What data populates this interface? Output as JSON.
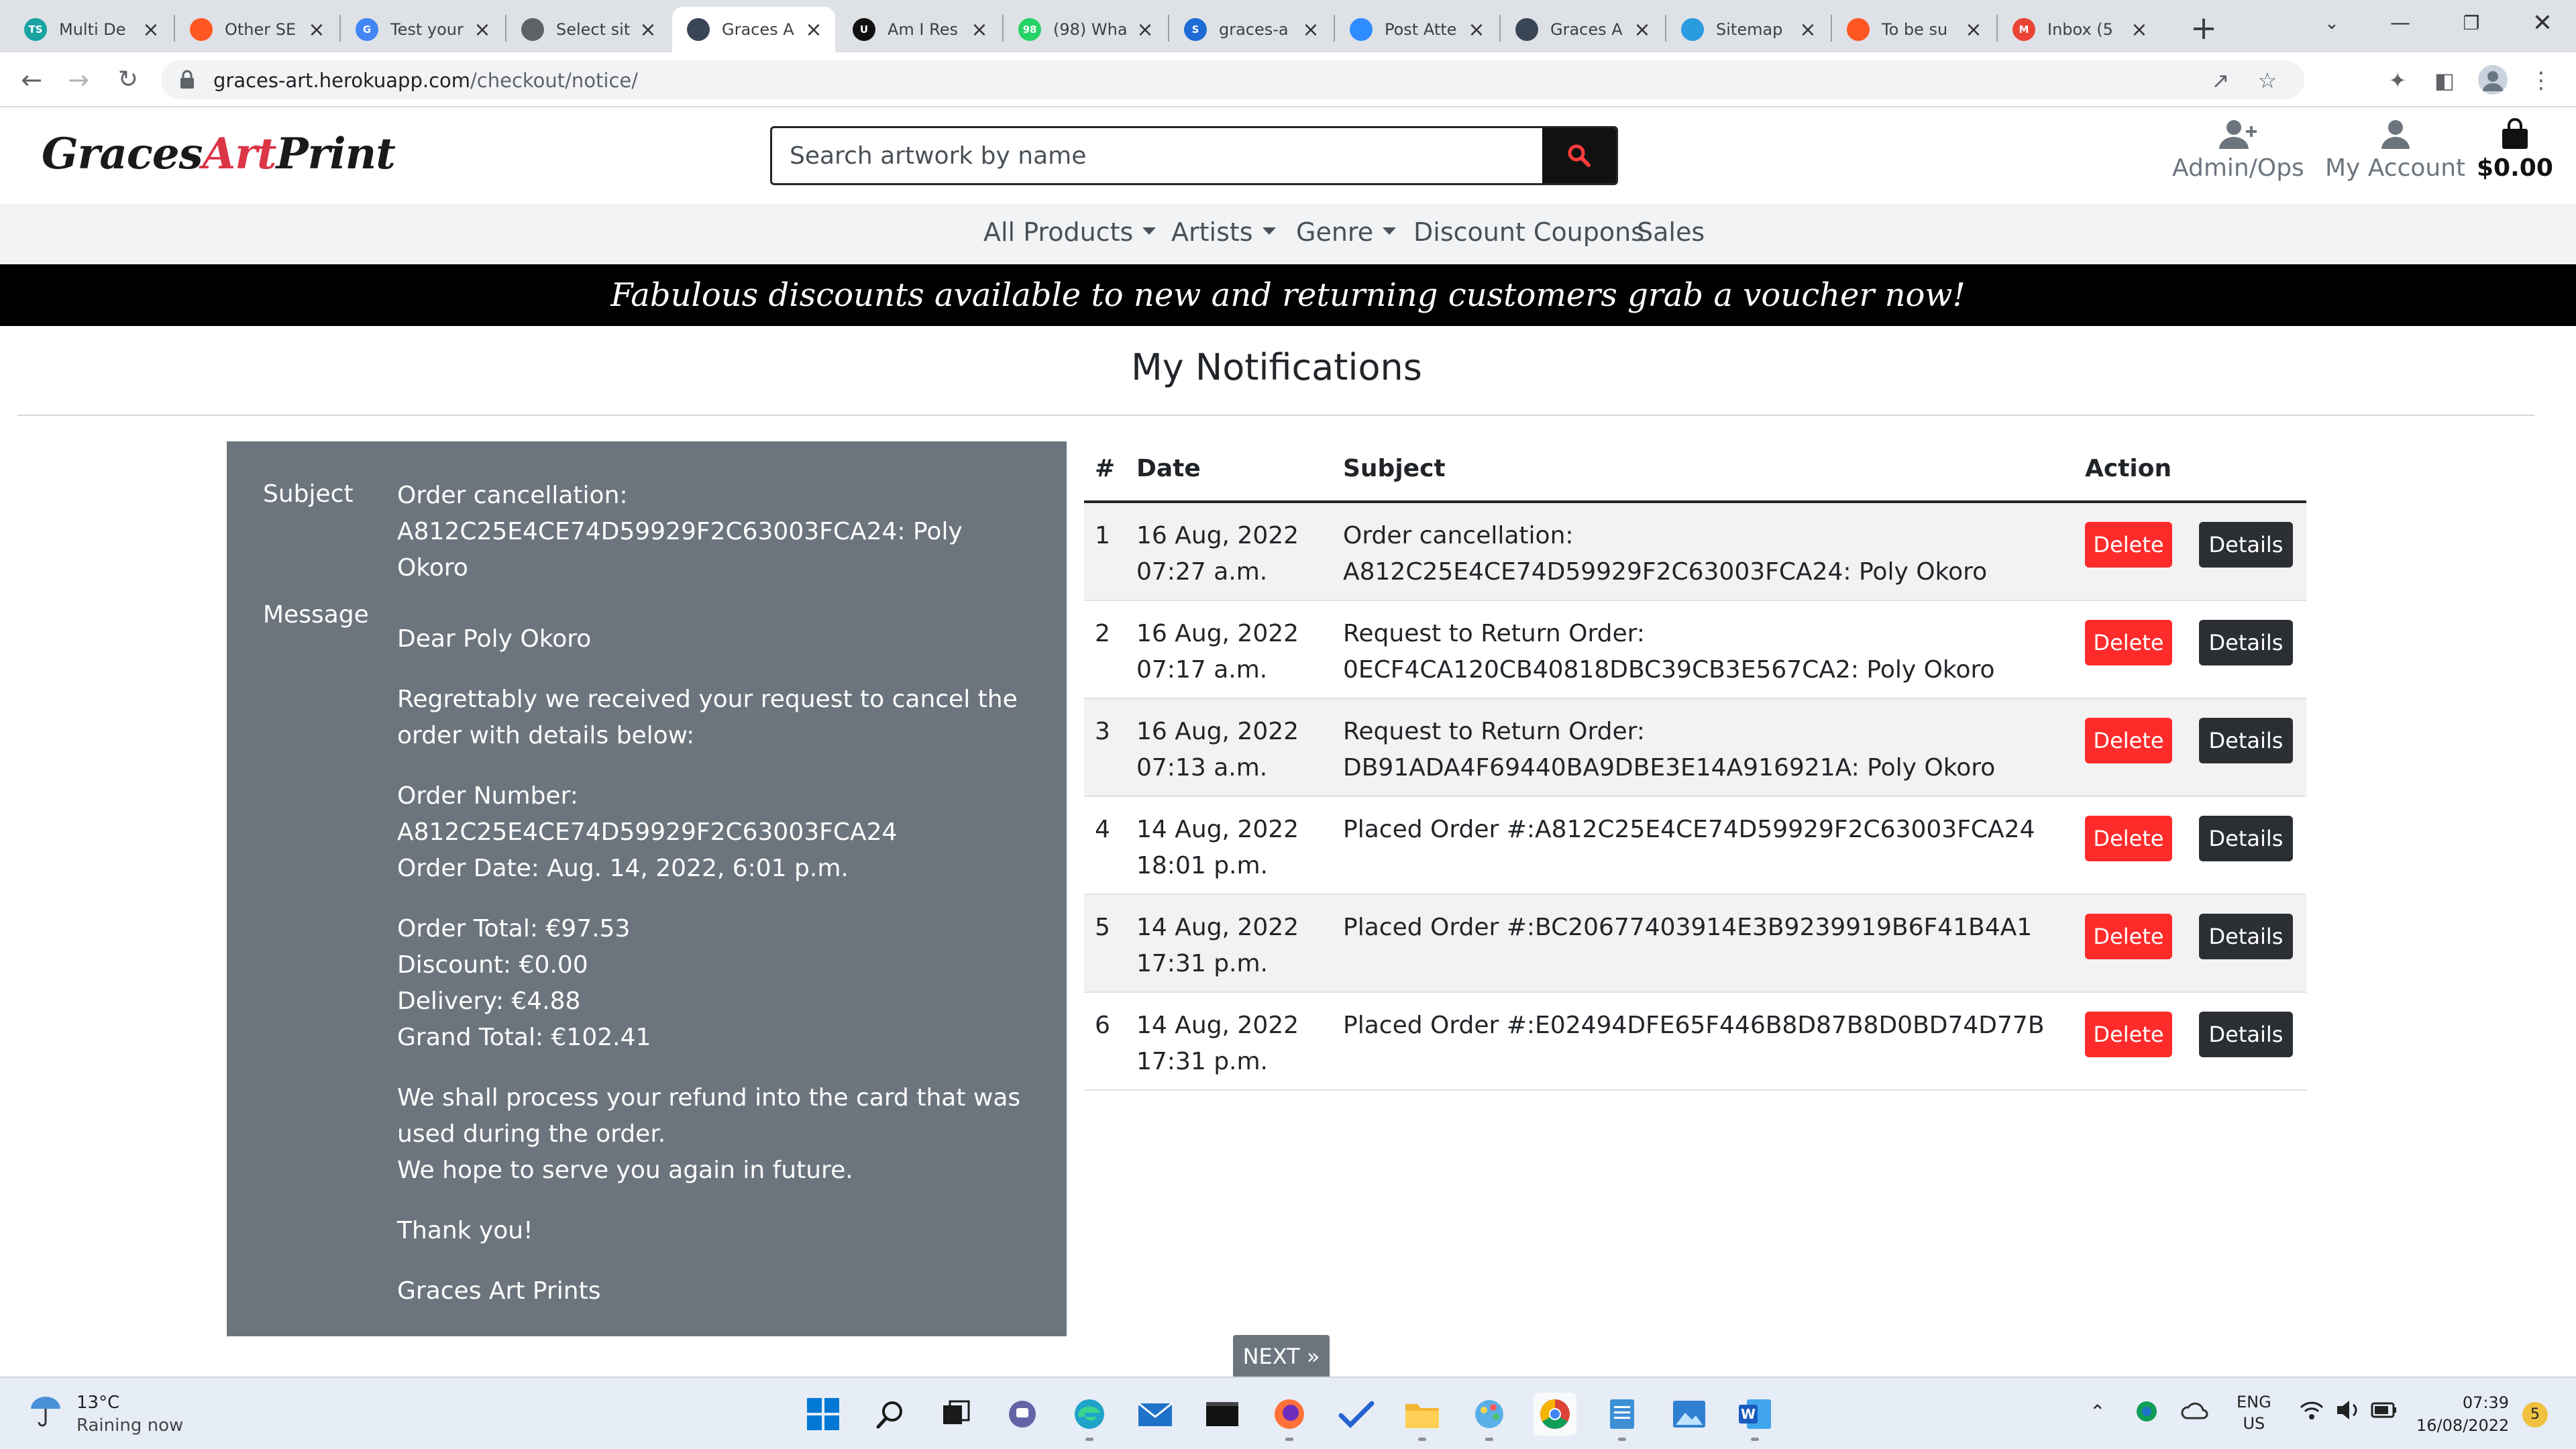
{
  "browser": {
    "tabs": [
      {
        "title": "Multi De",
        "favicon": "ts-circle-icon",
        "color": "#19a3a3",
        "glyph": "TS"
      },
      {
        "title": "Other SE",
        "favicon": "ring-icon",
        "color": "#ff5722",
        "glyph": ""
      },
      {
        "title": "Test your",
        "favicon": "google-icon",
        "color": "#4285f4",
        "glyph": "G"
      },
      {
        "title": "Select sit",
        "favicon": "globe-icon",
        "color": "#5f6368",
        "glyph": ""
      },
      {
        "title": "Graces A",
        "favicon": "graces-icon",
        "color": "#3a4655",
        "glyph": ""
      },
      {
        "title": "Am I Res",
        "favicon": "uploader-icon",
        "color": "#111111",
        "glyph": "U"
      },
      {
        "title": "(98) Wha",
        "favicon": "whatsapp-icon",
        "color": "#25d366",
        "glyph": "98"
      },
      {
        "title": "graces-a",
        "favicon": "s-icon",
        "color": "#1e6bd6",
        "glyph": "S"
      },
      {
        "title": "Post Atte",
        "favicon": "video-icon",
        "color": "#2d8cff",
        "glyph": ""
      },
      {
        "title": "Graces A",
        "favicon": "graces-icon",
        "color": "#3a4655",
        "glyph": ""
      },
      {
        "title": "Sitemap",
        "favicon": "sitemap-icon",
        "color": "#2b9be0",
        "glyph": ""
      },
      {
        "title": "To be su",
        "favicon": "ring-icon",
        "color": "#ff5722",
        "glyph": ""
      },
      {
        "title": "Inbox (5",
        "favicon": "gmail-icon",
        "color": "#ea4335",
        "glyph": "M"
      }
    ],
    "active_tab": 4,
    "url_host": "graces-art.herokuapp.com",
    "url_path": "/checkout/notice/"
  },
  "site": {
    "logo": {
      "part1": "Graces",
      "part2": "Art",
      "part3": "Print"
    },
    "search_placeholder": "Search artwork by name",
    "header_links": {
      "admin": "Admin/Ops",
      "account": "My Account",
      "bag": "$0.00"
    },
    "nav": [
      "All Products",
      "Artists",
      "Genre",
      "Discount Coupons",
      "Sales"
    ],
    "banner": "Fabulous discounts available to new and returning customers grab a voucher now!",
    "page_title": "My Notifications",
    "colors": {
      "accent": "#dc3545",
      "panel": "#6c757d",
      "delete": "#ff2b2b",
      "details": "#2b2f33"
    }
  },
  "detail": {
    "subject_label": "Subject",
    "subject": "Order cancellation: A812C25E4CE74D59929F2C63003FCA24: Poly Okoro",
    "message_label": "Message",
    "greeting": "Dear Poly Okoro",
    "para1": "Regrettably we received your request to cancel the order with details below:",
    "order_number_line": "Order Number:",
    "order_number": "A812C25E4CE74D59929F2C63003FCA24",
    "order_date": "Order Date: Aug. 14, 2022, 6:01 p.m.",
    "order_total": "Order Total: €97.53",
    "discount": "Discount: €0.00",
    "delivery": "Delivery: €4.88",
    "grand_total": "Grand Total: €102.41",
    "refund1": "We shall process your refund into the card that was used during the order.",
    "refund2": "We hope to serve you again in future.",
    "thanks": "Thank you!",
    "signature": "Graces Art Prints"
  },
  "table": {
    "headers": {
      "num": "#",
      "date": "Date",
      "subject": "Subject",
      "action": "Action"
    },
    "delete_label": "Delete",
    "details_label": "Details",
    "rows": [
      {
        "num": "1",
        "date": "16 Aug, 2022",
        "time": "07:27 a.m.",
        "subject": "Order cancellation: A812C25E4CE74D59929F2C63003FCA24: Poly Okoro"
      },
      {
        "num": "2",
        "date": "16 Aug, 2022",
        "time": "07:17 a.m.",
        "subject": "Request to Return Order: 0ECF4CA120CB40818DBC39CB3E567CA2: Poly Okoro"
      },
      {
        "num": "3",
        "date": "16 Aug, 2022",
        "time": "07:13 a.m.",
        "subject": "Request to Return Order: DB91ADA4F69440BA9DBE3E14A916921A: Poly Okoro"
      },
      {
        "num": "4",
        "date": "14 Aug, 2022",
        "time": "18:01 p.m.",
        "subject": "Placed Order #:A812C25E4CE74D59929F2C63003FCA24"
      },
      {
        "num": "5",
        "date": "14 Aug, 2022",
        "time": "17:31 p.m.",
        "subject": "Placed Order #:BC20677403914E3B9239919B6F41B4A1"
      },
      {
        "num": "6",
        "date": "14 Aug, 2022",
        "time": "17:31 p.m.",
        "subject": "Placed Order #:E02494DFE65F446B8D87B8D0BD74D77B"
      }
    ]
  },
  "pagination": {
    "next": "NEXT »"
  },
  "taskbar": {
    "weather_temp": "13°C",
    "weather_desc": "Raining now",
    "lang1": "ENG",
    "lang2": "US",
    "time": "07:39",
    "date": "16/08/2022",
    "notifications": "5"
  }
}
